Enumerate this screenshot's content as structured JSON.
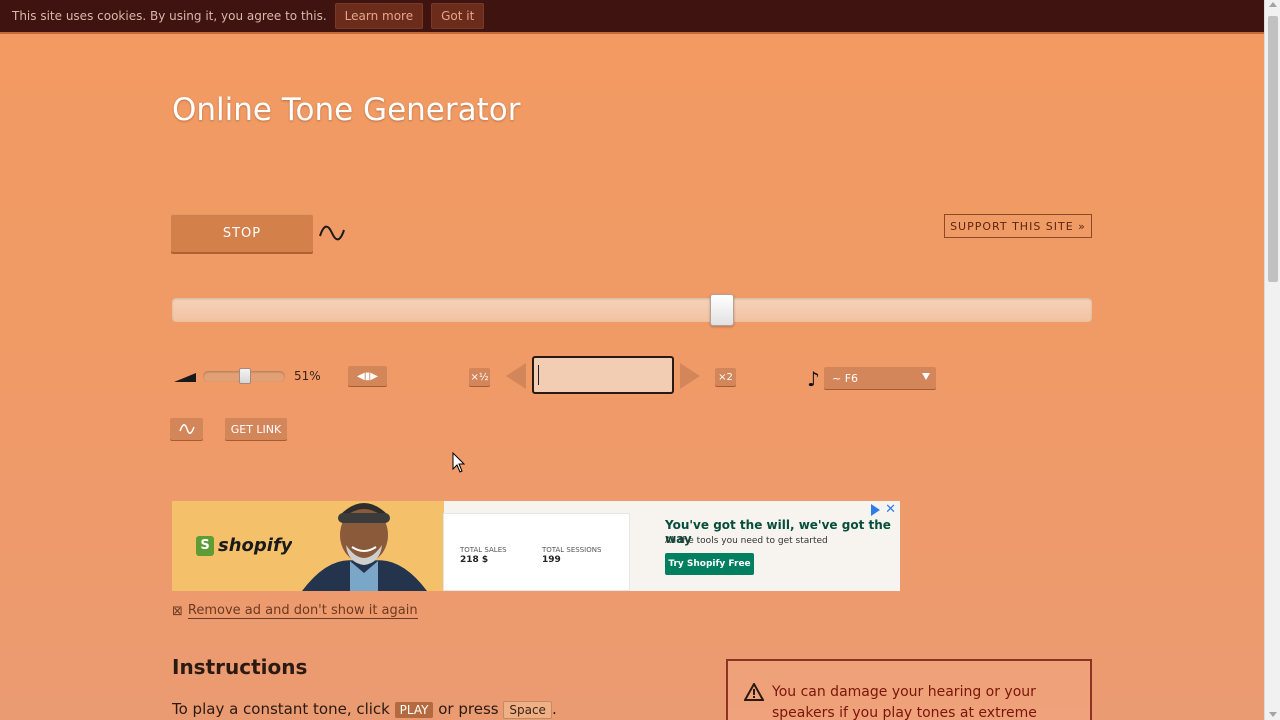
{
  "cookie_bar": {
    "text": "This site uses cookies. By using it, you agree to this.",
    "learn_more": "Learn more",
    "got_it": "Got it"
  },
  "page": {
    "title": "Online Tone Generator"
  },
  "controls": {
    "stop_label": "STOP",
    "support_label": "SUPPORT THIS SITE »",
    "frequency_slider_position": 0.6,
    "volume_percent": "51%",
    "volume_level": 0.51,
    "halve_label": "×½",
    "double_label": "×2",
    "frequency_value": "",
    "note_selected": "~ F6",
    "get_link_label": "GET LINK"
  },
  "ad": {
    "brand": "shopify",
    "headline": "You've got the will, we've got the way",
    "subline": "All the tools you need to get started",
    "cta": "Try Shopify Free",
    "stat1_label": "TOTAL SALES",
    "stat1_value": "218 $",
    "stat2_label": "TOTAL SESSIONS",
    "stat2_value": "199"
  },
  "remove_ad": "Remove ad and don't show it again",
  "instructions": {
    "heading": "Instructions",
    "line_pre": "To play a constant tone, click",
    "play_key": "PLAY",
    "line_mid": "or press",
    "space_key": "Space",
    "line_post": "."
  },
  "warning": {
    "text": "You can damage your hearing or your speakers if you play tones at extreme"
  },
  "colors": {
    "background": "#f29a61",
    "accent_button": "#d3865a",
    "cookie_bar": "#3e1310",
    "warning": "#7a1509"
  }
}
